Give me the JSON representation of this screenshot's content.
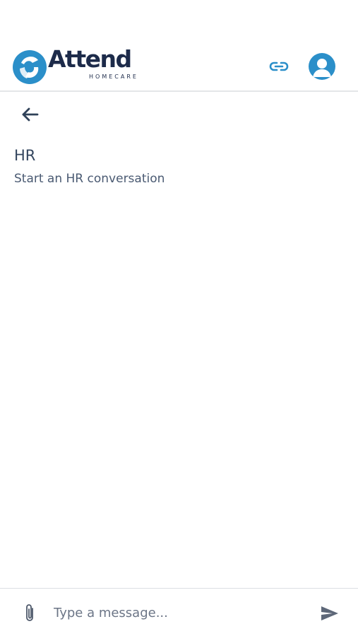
{
  "brand": {
    "name": "Attend",
    "sub": "HOMECARE",
    "primary_color": "#2b8fc9",
    "text_color": "#1d2b4a"
  },
  "header": {
    "icons": {
      "link": "link-icon",
      "profile": "user-avatar-icon"
    }
  },
  "nav": {
    "back_icon": "arrow-left-icon"
  },
  "conversation": {
    "title": "HR",
    "subtitle": "Start an HR conversation"
  },
  "composer": {
    "attach_icon": "paperclip-icon",
    "placeholder": "Type a message...",
    "value": "",
    "send_icon": "send-icon"
  }
}
